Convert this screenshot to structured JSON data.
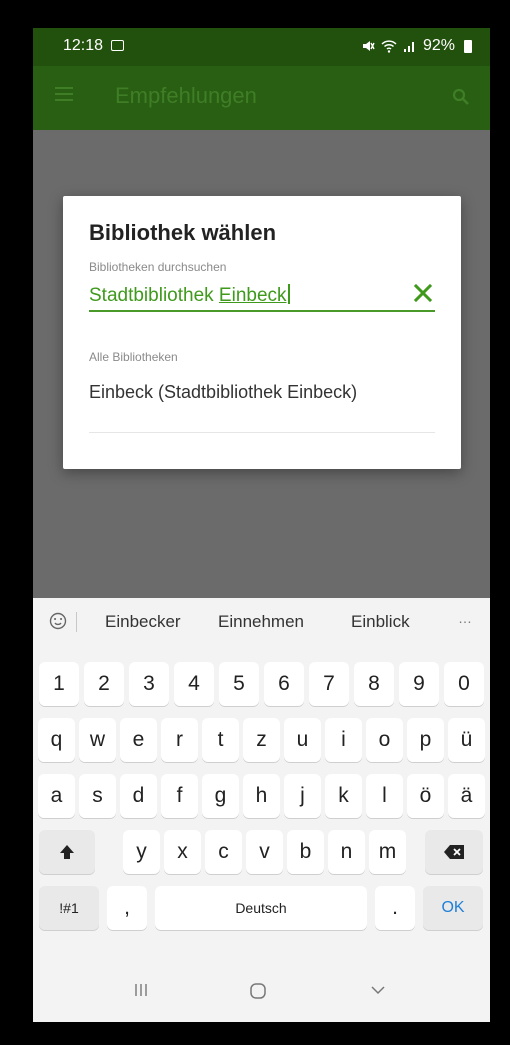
{
  "status_bar": {
    "time": "12:18",
    "signal_text": "♪♯ ≈ .∥",
    "battery": "92%"
  },
  "app_bar": {
    "title": "Empfehlungen"
  },
  "dialog": {
    "title": "Bibliothek wählen",
    "search_hint": "Bibliotheken durchsuchen",
    "search_value_prefix": "Stadtbibliothek ",
    "search_value_word": "Einbeck",
    "section_label": "Alle Bibliotheken",
    "result_item": "Einbeck (Stadtbibliothek Einbeck)"
  },
  "keyboard": {
    "suggestions": [
      "Einbecker",
      "Einnehmen",
      "Einblick"
    ],
    "more": "…",
    "row_numbers": [
      "1",
      "2",
      "3",
      "4",
      "5",
      "6",
      "7",
      "8",
      "9",
      "0"
    ],
    "row_top": [
      "q",
      "w",
      "e",
      "r",
      "t",
      "z",
      "u",
      "i",
      "o",
      "p",
      "ü"
    ],
    "row_mid": [
      "a",
      "s",
      "d",
      "f",
      "g",
      "h",
      "j",
      "k",
      "l",
      "ö",
      "ä"
    ],
    "row_bottom": [
      "y",
      "x",
      "c",
      "v",
      "b",
      "n",
      "m"
    ],
    "symbols_label": "!#1",
    "comma": ",",
    "space_label": "Deutsch",
    "period": ".",
    "enter_label": "OK"
  },
  "colors": {
    "status_bar": "#22500d",
    "app_bar": "#285f12",
    "accent_green": "#3f9a1c",
    "ok_blue": "#1f7fd8"
  }
}
